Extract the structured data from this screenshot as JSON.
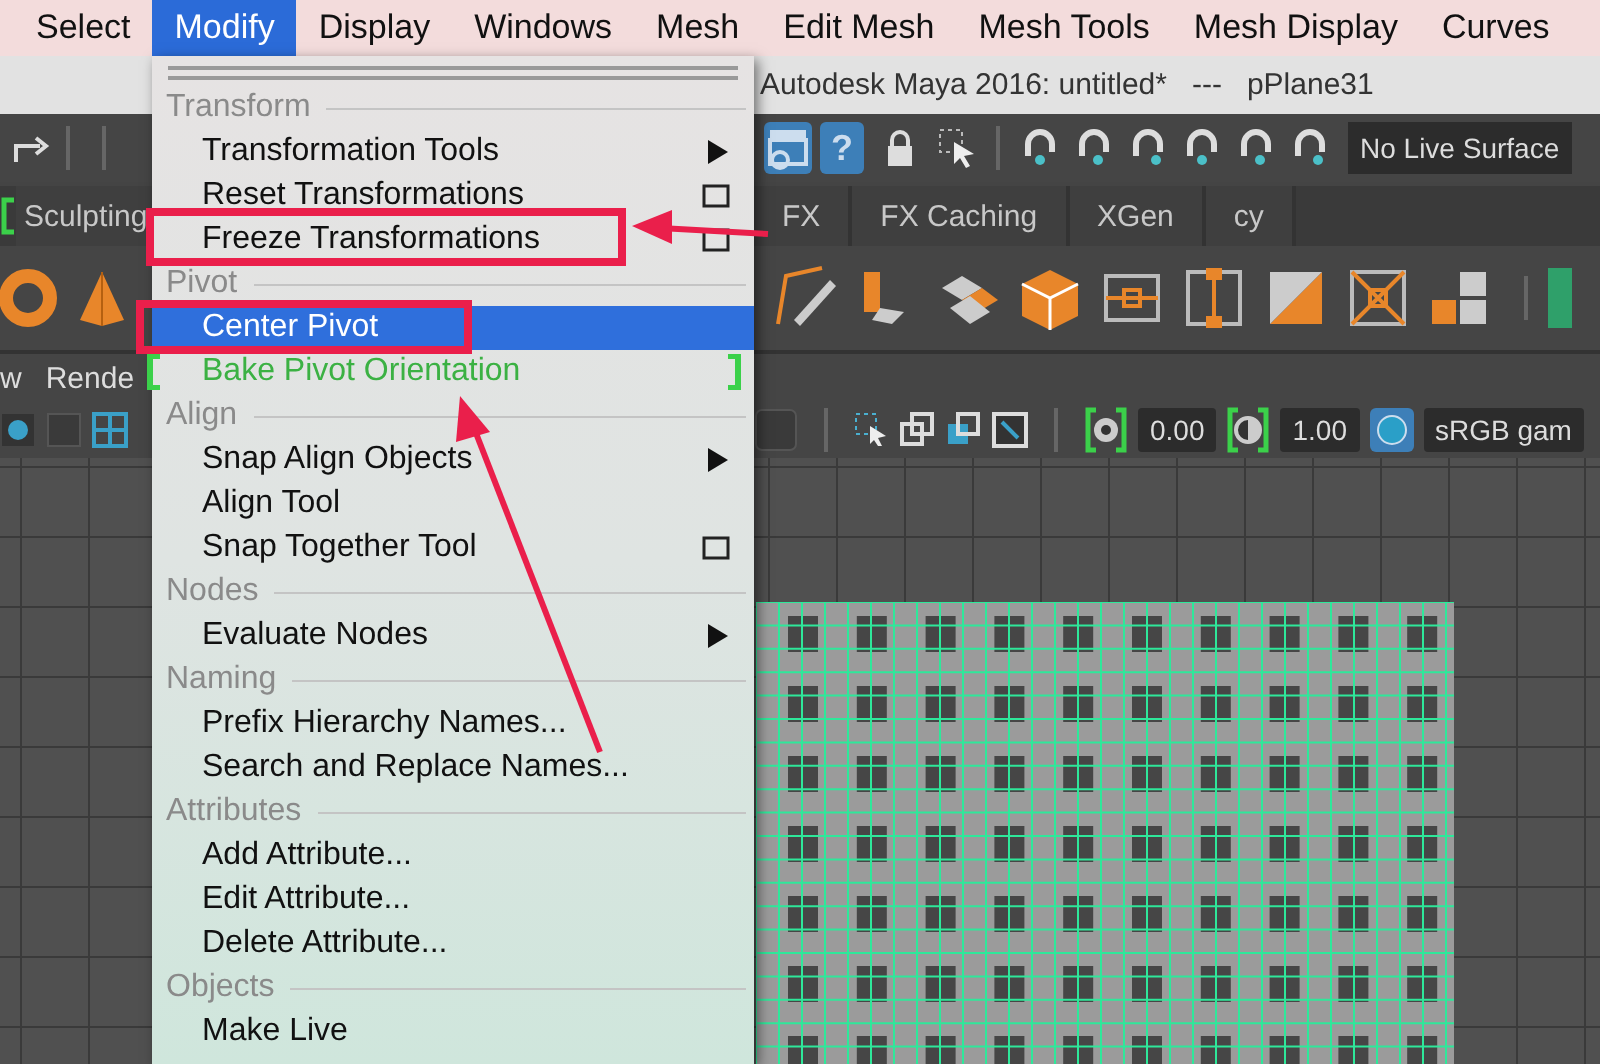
{
  "menu_bar": [
    {
      "label": "Select",
      "selected": false
    },
    {
      "label": "Modify",
      "selected": true
    },
    {
      "label": "Display",
      "selected": false
    },
    {
      "label": "Windows",
      "selected": false
    },
    {
      "label": "Mesh",
      "selected": false
    },
    {
      "label": "Edit Mesh",
      "selected": false
    },
    {
      "label": "Mesh Tools",
      "selected": false
    },
    {
      "label": "Mesh Display",
      "selected": false
    },
    {
      "label": "Curves",
      "selected": false
    }
  ],
  "window": {
    "title": "Autodesk Maya 2016: untitled*   ---   pPlane31"
  },
  "status_line": {
    "help_glyph": "?",
    "live_surface": "No Live Surface"
  },
  "shelf_tabs": [
    {
      "label": "Sculpting"
    },
    {
      "label": "FX"
    },
    {
      "label": "FX Caching"
    },
    {
      "label": "XGen"
    },
    {
      "label": "cy"
    }
  ],
  "panel_menu": [
    "w",
    "Rende"
  ],
  "panel_toolbar": {
    "exposure": "0.00",
    "gamma": "1.00",
    "color_space": "sRGB gam"
  },
  "dropdown": {
    "sections": [
      {
        "header": "Transform",
        "items": [
          {
            "label": "Transformation Tools",
            "kind": "submenu",
            "selected": false
          },
          {
            "label": "Reset Transformations",
            "kind": "option",
            "selected": false
          },
          {
            "label": "Freeze Transformations",
            "kind": "option",
            "selected": false
          }
        ]
      },
      {
        "header": "Pivot",
        "items": [
          {
            "label": "Center Pivot",
            "kind": "plain",
            "selected": true
          },
          {
            "label": "Bake Pivot Orientation",
            "kind": "marked",
            "selected": false
          }
        ]
      },
      {
        "header": "Align",
        "items": [
          {
            "label": "Snap Align Objects",
            "kind": "submenu",
            "selected": false
          },
          {
            "label": "Align Tool",
            "kind": "plain",
            "selected": false
          },
          {
            "label": "Snap Together Tool",
            "kind": "option",
            "selected": false
          }
        ]
      },
      {
        "header": "Nodes",
        "items": [
          {
            "label": "Evaluate Nodes",
            "kind": "submenu",
            "selected": false
          }
        ]
      },
      {
        "header": "Naming",
        "items": [
          {
            "label": "Prefix Hierarchy Names...",
            "kind": "plain",
            "selected": false
          },
          {
            "label": "Search and Replace Names...",
            "kind": "plain",
            "selected": false
          }
        ]
      },
      {
        "header": "Attributes",
        "items": [
          {
            "label": "Add Attribute...",
            "kind": "plain",
            "selected": false
          },
          {
            "label": "Edit Attribute...",
            "kind": "plain",
            "selected": false
          },
          {
            "label": "Delete Attribute...",
            "kind": "plain",
            "selected": false
          }
        ]
      },
      {
        "header": "Objects",
        "items": [
          {
            "label": "Make Live",
            "kind": "plain",
            "selected": false
          }
        ]
      }
    ]
  }
}
